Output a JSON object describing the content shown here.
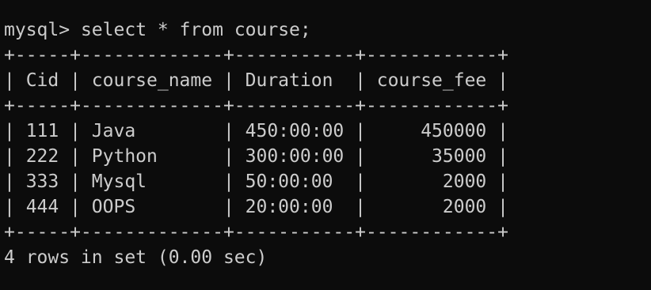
{
  "terminal": {
    "prompt": "mysql>",
    "command": "select * from course;",
    "columns": [
      "Cid",
      "course_name",
      "Duration",
      "course_fee"
    ],
    "rows": [
      [
        "111",
        "Java",
        "450:00:00",
        "450000"
      ],
      [
        "222",
        "Python",
        "300:00:00",
        "35000"
      ],
      [
        "333",
        "Mysql",
        "50:00:00",
        "2000"
      ],
      [
        "444",
        "OOPS",
        "20:00:00",
        "2000"
      ]
    ],
    "summary": "4 rows in set (0.00 sec)"
  },
  "colors": {
    "background": "#0c0c0c",
    "text": "#cccccc"
  }
}
